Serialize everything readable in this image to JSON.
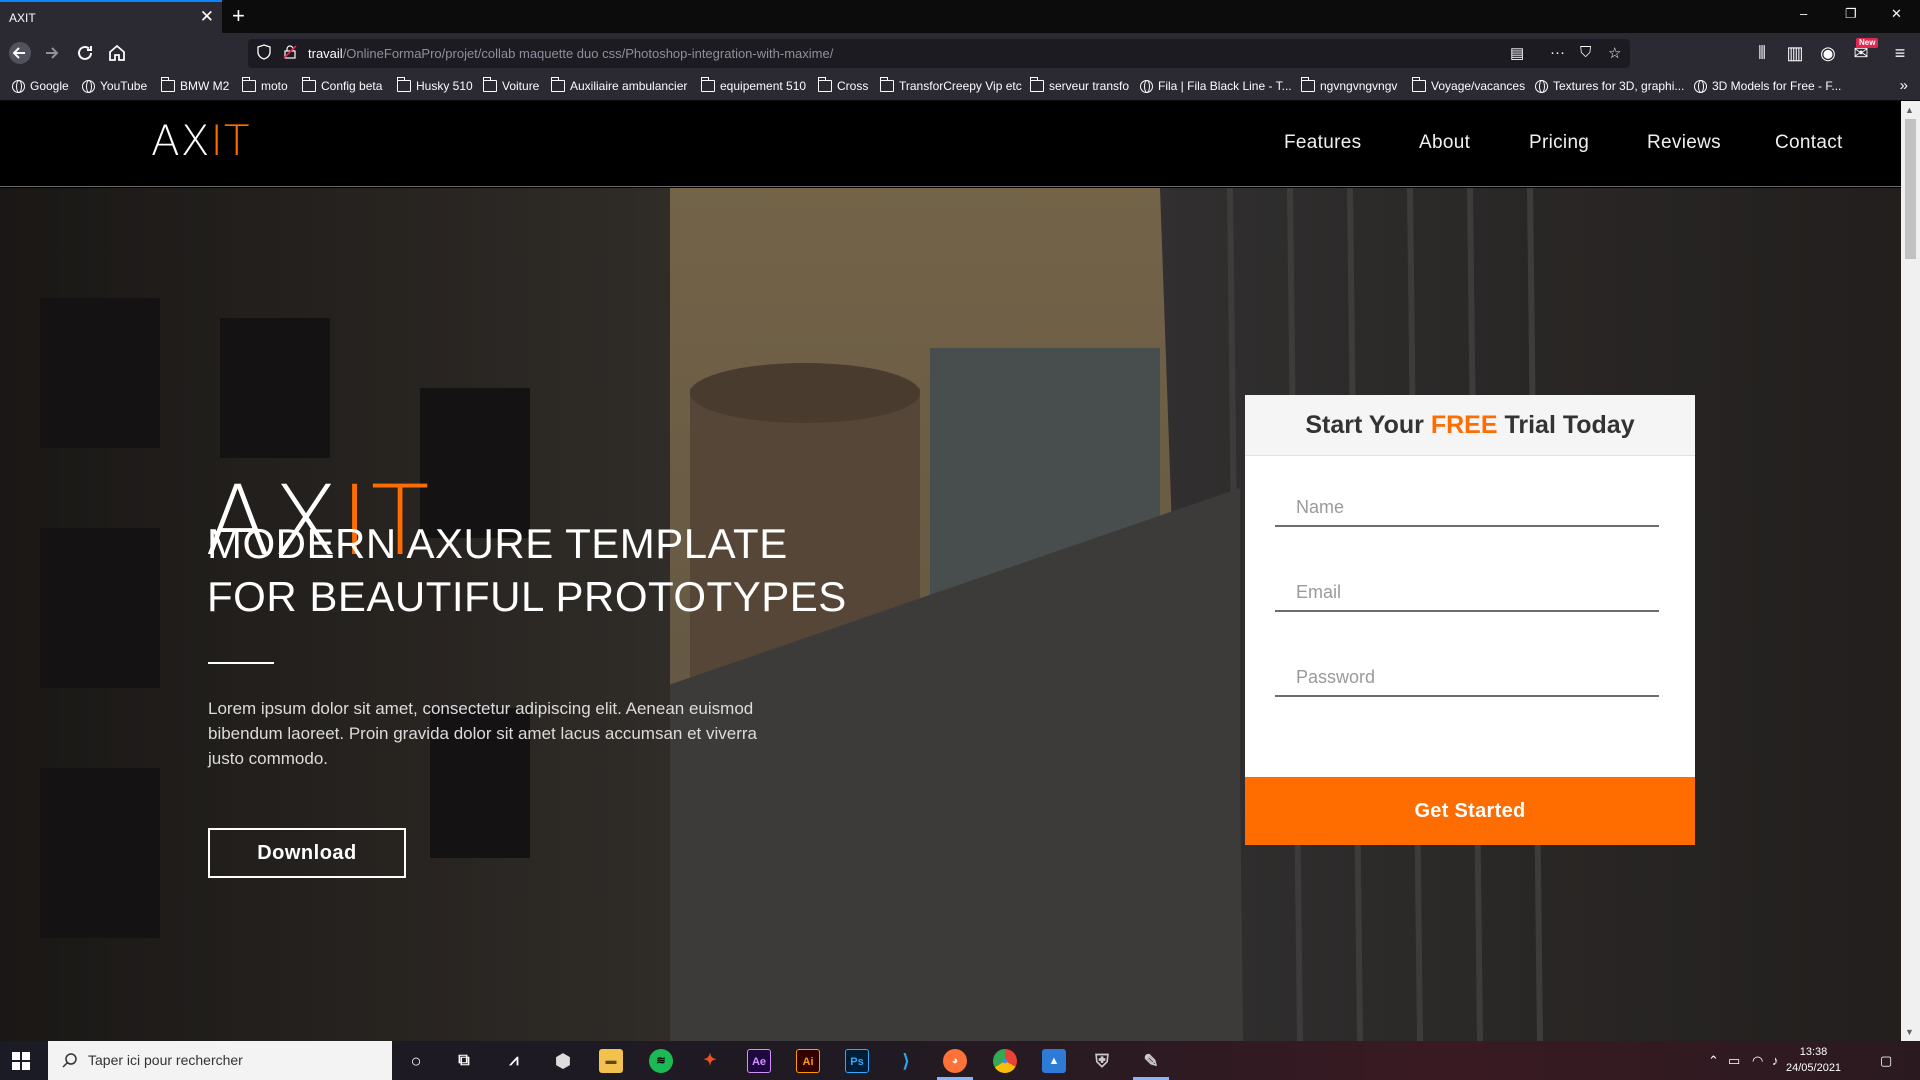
{
  "browser": {
    "tab_title": "AXIT",
    "tab_close": "✕",
    "new_tab": "+",
    "window_controls": {
      "minimize": "–",
      "restore": "❐",
      "close": "✕"
    },
    "url_host": "travail",
    "url_path": "/OnlineFormaPro/projet/collab maquette duo css/Photoshop-integration-with-maxime/",
    "new_badge": "New",
    "bookmarks": [
      {
        "label": "Google",
        "icon": "globe-icon"
      },
      {
        "label": "YouTube",
        "icon": "globe-icon"
      },
      {
        "label": "BMW M2",
        "icon": "folder-icon"
      },
      {
        "label": "moto",
        "icon": "folder-icon"
      },
      {
        "label": "Config beta",
        "icon": "folder-icon"
      },
      {
        "label": "Husky 510",
        "icon": "folder-icon"
      },
      {
        "label": "Voiture",
        "icon": "folder-icon"
      },
      {
        "label": "Auxiliaire ambulancier",
        "icon": "folder-icon"
      },
      {
        "label": "equipement 510",
        "icon": "folder-icon"
      },
      {
        "label": "Cross",
        "icon": "folder-icon"
      },
      {
        "label": "TransforCreepy Vip etc",
        "icon": "folder-icon"
      },
      {
        "label": "serveur transfo",
        "icon": "folder-icon"
      },
      {
        "label": "Fila | Fila Black Line - T...",
        "icon": "globe-icon"
      },
      {
        "label": "ngvngvngvngv",
        "icon": "folder-icon"
      },
      {
        "label": "Voyage/vacances",
        "icon": "folder-icon"
      },
      {
        "label": "Textures for 3D, graphi...",
        "icon": "globe-icon"
      },
      {
        "label": "3D Models for Free - F...",
        "icon": "globe-icon"
      }
    ],
    "bookmarks_more": "»"
  },
  "site": {
    "logo_ax": "AX",
    "logo_it": "IT",
    "nav": [
      "Features",
      "About",
      "Pricing",
      "Reviews",
      "Contact"
    ],
    "hero": {
      "logo_ax": "AX",
      "logo_it": "IT",
      "headline_line1": "MODERN AXURE TEMPLATE",
      "headline_line2": "FOR BEAUTIFUL PROTOTYPES",
      "text": "Lorem ipsum dolor sit amet, consectetur adipiscing elit. Aenean euismod bibendum laoreet. Proin gravida dolor sit amet lacus accumsan et viverra justo commodo.",
      "download_label": "Download"
    },
    "signup": {
      "title_pre": "Start Your ",
      "title_free": "FREE",
      "title_post": " Trial Today",
      "name_placeholder": "Name",
      "email_placeholder": "Email",
      "password_placeholder": "Password",
      "button_label": "Get Started"
    }
  },
  "taskbar": {
    "search_placeholder": "Taper ici pour rechercher",
    "time": "13:38",
    "date": "24/05/2021",
    "apps": [
      "cortana",
      "task-view",
      "unknown-app",
      "settings",
      "file-explorer",
      "spotify",
      "figma",
      "after-effects",
      "illustrator",
      "photoshop",
      "vscode",
      "firefox",
      "chrome",
      "photos",
      "shield-app",
      "paint-app"
    ]
  },
  "colors": {
    "accent": "#ff6c00",
    "nav_bg": "#000000",
    "browser_chrome": "#2b2a33"
  }
}
